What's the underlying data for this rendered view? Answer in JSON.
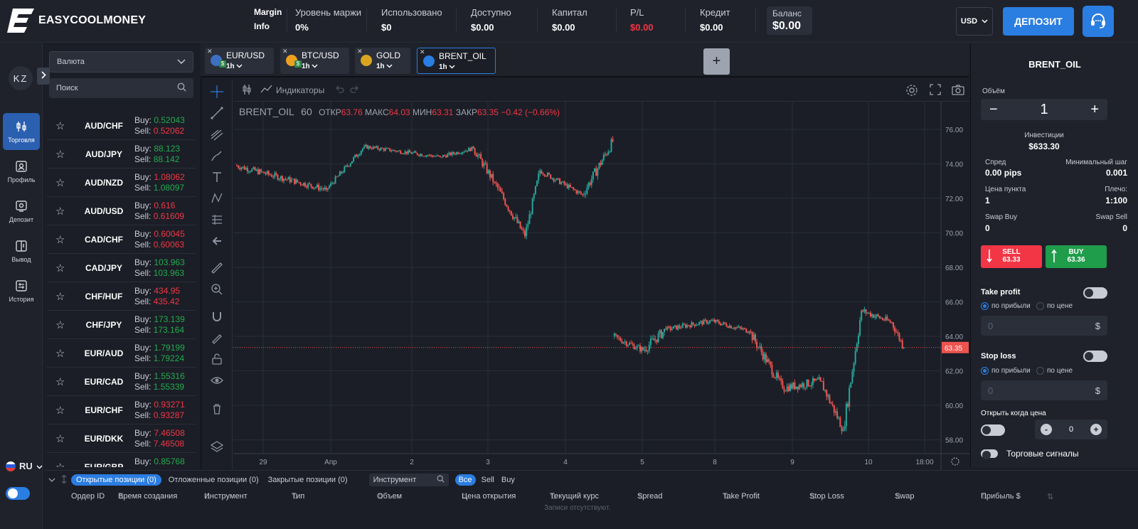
{
  "brand": {
    "name": "EASYCOOLMONEY"
  },
  "header": {
    "margin_info": {
      "label": "Margin",
      "value": "Info"
    },
    "stats": [
      {
        "label": "Уровень маржи",
        "value": "0%"
      },
      {
        "label": "Использовано",
        "value": "$0"
      },
      {
        "label": "Доступно",
        "value": "$0.00"
      },
      {
        "label": "Капитал",
        "value": "$0.00"
      },
      {
        "label": "P/L",
        "value": "$0.00"
      },
      {
        "label": "Кредит",
        "value": "$0.00"
      }
    ],
    "balance": {
      "label": "Баланс",
      "value": "$0.00"
    },
    "currency": "USD",
    "deposit_label": "ДЕПОЗИТ",
    "pl_color": "#f23645"
  },
  "rail": {
    "avatar": "KZ",
    "items": [
      {
        "label": "Торговля",
        "icon": "candles-icon",
        "active": true
      },
      {
        "label": "Профиль",
        "icon": "profile-icon"
      },
      {
        "label": "Депозит",
        "icon": "deposit-icon"
      },
      {
        "label": "Вывод",
        "icon": "withdraw-icon"
      },
      {
        "label": "История",
        "icon": "history-icon"
      }
    ],
    "language": "RU"
  },
  "instruments": {
    "category": "Валюта",
    "search_placeholder": "Поиск",
    "buy_label": "Buy:",
    "sell_label": "Sell:",
    "list": [
      {
        "symbol": "AUD/CHF",
        "buy": "0.52043",
        "sell": "0.52062",
        "buy_color": "green",
        "sell_color": "red"
      },
      {
        "symbol": "AUD/JPY",
        "buy": "88.123",
        "sell": "88.142",
        "buy_color": "green",
        "sell_color": "green"
      },
      {
        "symbol": "AUD/NZD",
        "buy": "1.08062",
        "sell": "1.08097",
        "buy_color": "red",
        "sell_color": "green"
      },
      {
        "symbol": "AUD/USD",
        "buy": "0.616",
        "sell": "0.61609",
        "buy_color": "red",
        "sell_color": "red"
      },
      {
        "symbol": "CAD/CHF",
        "buy": "0.60045",
        "sell": "0.60063",
        "buy_color": "red",
        "sell_color": "red"
      },
      {
        "symbol": "CAD/JPY",
        "buy": "103.963",
        "sell": "103.963",
        "buy_color": "green",
        "sell_color": "green"
      },
      {
        "symbol": "CHF/HUF",
        "buy": "434.95",
        "sell": "435.42",
        "buy_color": "red",
        "sell_color": "red"
      },
      {
        "symbol": "CHF/JPY",
        "buy": "173.139",
        "sell": "173.164",
        "buy_color": "green",
        "sell_color": "green"
      },
      {
        "symbol": "EUR/AUD",
        "buy": "1.79199",
        "sell": "1.79224",
        "buy_color": "green",
        "sell_color": "green"
      },
      {
        "symbol": "EUR/CAD",
        "buy": "1.55316",
        "sell": "1.55339",
        "buy_color": "green",
        "sell_color": "green"
      },
      {
        "symbol": "EUR/CHF",
        "buy": "0.93271",
        "sell": "0.93287",
        "buy_color": "red",
        "sell_color": "red"
      },
      {
        "symbol": "EUR/DKK",
        "buy": "7.46508",
        "sell": "7.46508",
        "buy_color": "red",
        "sell_color": "red"
      },
      {
        "symbol": "EUR/GBP",
        "buy": "0.85768",
        "sell": "",
        "buy_color": "green",
        "sell_color": "green"
      }
    ]
  },
  "tabs": [
    {
      "name": "EUR/USD",
      "tf": "1h",
      "icon_color": "#3d6fc4",
      "badge_color": "#2f8a4a"
    },
    {
      "name": "BTC/USD",
      "tf": "1h",
      "icon_color": "#f0a020",
      "badge_color": "#2f8a4a"
    },
    {
      "name": "GOLD",
      "tf": "1h",
      "icon_color": "#d9a520",
      "badge_color": ""
    },
    {
      "name": "BRENT_OIL",
      "tf": "1h",
      "icon_color": "#2a7de1",
      "badge_color": "",
      "active": true
    }
  ],
  "add_tab": "+",
  "chart_toolbar": {
    "indicators": "Индикаторы"
  },
  "legend": {
    "symbol": "BRENT_OIL",
    "interval": "60",
    "open_label": "ОТКР",
    "open": "63.76",
    "high_label": "МАКС",
    "high": "64.03",
    "low_label": "МИН",
    "low": "63.31",
    "close_label": "ЗАКР",
    "close": "63.35",
    "change": "−0.42 (−0.66%)"
  },
  "chart_data": {
    "type": "candlestick",
    "y_ticks": [
      "76.00",
      "74.00",
      "72.00",
      "70.00",
      "68.00",
      "66.00",
      "64.00",
      "62.00",
      "60.00",
      "58.00"
    ],
    "ylim": [
      57.2,
      77.6
    ],
    "x_ticks": [
      {
        "label": "29",
        "i": 3
      },
      {
        "label": "Апр",
        "i": 13
      },
      {
        "label": "2",
        "i": 23
      },
      {
        "label": "3",
        "i": 33
      },
      {
        "label": "4",
        "i": 43
      },
      {
        "label": "5",
        "i": 53
      },
      {
        "label": "8",
        "i": 63
      },
      {
        "label": "9",
        "i": 73
      },
      {
        "label": "10",
        "i": 83
      },
      {
        "label": "18:00",
        "i": 90
      }
    ],
    "last_price": "63.35",
    "up_color": "#26a69a",
    "down_color": "#ef5350",
    "segments": [
      {
        "start": 73.9,
        "end": 72.5,
        "bars": 60,
        "volatility": 0.18
      },
      {
        "start": 72.5,
        "end": 75.0,
        "bars": 25,
        "volatility": 0.16
      },
      {
        "start": 75.0,
        "end": 74.4,
        "bars": 50,
        "volatility": 0.12
      },
      {
        "start": 74.4,
        "end": 74.9,
        "bars": 22,
        "volatility": 0.12
      },
      {
        "start": 74.9,
        "end": 72.9,
        "bars": 14,
        "volatility": 0.25
      },
      {
        "start": 72.9,
        "end": 69.8,
        "bars": 20,
        "volatility": 0.28
      },
      {
        "start": 69.8,
        "end": 73.6,
        "bars": 10,
        "volatility": 0.3
      },
      {
        "start": 73.6,
        "end": 72.2,
        "bars": 28,
        "volatility": 0.15
      },
      {
        "start": 72.2,
        "end": 75.3,
        "bars": 20,
        "volatility": 0.3
      },
      {
        "start": 64.0,
        "end": 63.2,
        "bars": 20,
        "volatility": 0.2
      },
      {
        "start": 63.2,
        "end": 64.4,
        "bars": 15,
        "volatility": 0.3
      },
      {
        "start": 64.4,
        "end": 64.9,
        "bars": 30,
        "volatility": 0.15
      },
      {
        "start": 64.9,
        "end": 64.3,
        "bars": 25,
        "volatility": 0.15
      },
      {
        "start": 64.3,
        "end": 61.0,
        "bars": 22,
        "volatility": 0.3
      },
      {
        "start": 61.0,
        "end": 61.4,
        "bars": 25,
        "volatility": 0.25
      },
      {
        "start": 61.4,
        "end": 58.6,
        "bars": 15,
        "volatility": 0.3
      },
      {
        "start": 58.6,
        "end": 65.5,
        "bars": 12,
        "volatility": 0.4
      },
      {
        "start": 65.5,
        "end": 64.8,
        "bars": 20,
        "volatility": 0.2
      },
      {
        "start": 64.8,
        "end": 63.35,
        "bars": 8,
        "volatility": 0.25
      }
    ]
  },
  "trade_panel": {
    "symbol": "BRENT_OIL",
    "volume_label": "Объём",
    "volume": "1",
    "investment_label": "Инвестиции",
    "investment": "$633.30",
    "spread_label": "Спред",
    "spread": "0.00 pips",
    "min_step_label": "Минимальный шаг",
    "min_step": "0.001",
    "point_price_label": "Цена пункта",
    "point_price": "1",
    "leverage_label": "Плечо:",
    "leverage": "1:100",
    "swap_buy_label": "Swap Buy",
    "swap_buy": "0",
    "swap_sell_label": "Swap Sell",
    "swap_sell": "0",
    "sell_label": "SELL",
    "sell_price": "63.33",
    "buy_label": "BUY",
    "buy_price": "63.36",
    "take_profit_label": "Take profit",
    "stop_loss_label": "Stop loss",
    "by_profit": "по прибыли",
    "by_price": "по цене",
    "input_value": "0",
    "currency_sign": "$",
    "open_when_price_label": "Открыть когда цена",
    "stepper_value": "0",
    "signals_label": "Торговые сигналы"
  },
  "positions": {
    "tabs": [
      {
        "label": "Открытые позиции (0)",
        "active": true
      },
      {
        "label": "Отложенные позиции (0)"
      },
      {
        "label": "Закрытые позиции (0)"
      }
    ],
    "instrument_placeholder": "Инструмент",
    "filters": [
      "Все",
      "Sell",
      "Buy"
    ],
    "columns": [
      "Ордер ID",
      "Время создания",
      "Инструмент",
      "Тип",
      "Объем",
      "Цена открытия",
      "Текущий курс",
      "Spread",
      "Take Profit",
      "Stop Loss",
      "Swap",
      "Прибыль $"
    ],
    "empty": "Записи отсутствуют."
  }
}
